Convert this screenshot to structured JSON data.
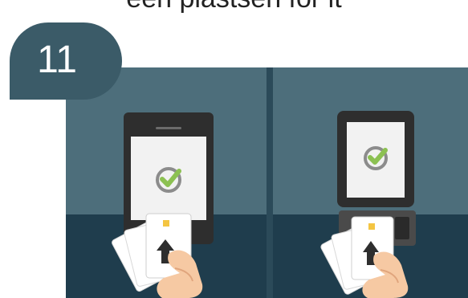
{
  "caption": "een plastsen for it",
  "step_number": "11",
  "colors": {
    "wall": "#4d6e7b",
    "floor": "#1f3d4d",
    "badge": "#3b5b68",
    "terminal": "#2e2e2e",
    "screen": "#f2f2f2",
    "check": "#8cc152",
    "hand": "#f6c9a3",
    "card": "#ffffff"
  },
  "panels": [
    {
      "device": "mobile-terminal",
      "screen_icon": "check-circle-icon",
      "action": "card-insert"
    },
    {
      "device": "countertop-terminal-with-card-reader",
      "screen_icon": "check-circle-icon",
      "action": "card-insert"
    }
  ]
}
